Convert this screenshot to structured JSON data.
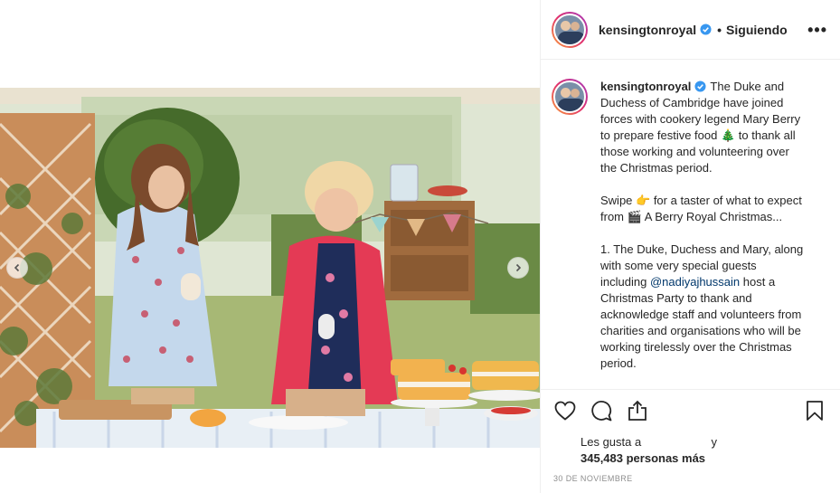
{
  "post": {
    "username": "kensingtonroyal",
    "separator": "•",
    "follow_label": "Siguiendo",
    "more_label": "•••",
    "caption_lines": [
      "The Duke and",
      "Duchess of Cambridge have joined",
      "forces with cookery legend Mary Berry",
      "to prepare festive food 🎄 to thank all",
      "those working and volunteering over",
      "the Christmas period.",
      "",
      "Swipe 👉 for a taster of what to expect",
      "from 🎬 A Berry Royal Christmas...",
      "",
      "1. The Duke, Duchess and Mary, along",
      "with some very special guests",
      "including ",
      "host a",
      "Christmas Party to thank and",
      "acknowledge staff and volunteers from",
      "charities and organisations who will be",
      "working tirelessly over the Christmas",
      "period."
    ],
    "mention": "@nadiyajhussain",
    "likes_prefix": "Les gusta a",
    "likes_and": "y",
    "likes_count": "345,483 personas más",
    "date": "30 DE NOVIEMBRE"
  },
  "icons": {
    "verified": "verified-badge-icon",
    "like": "heart-icon",
    "comment": "comment-icon",
    "share": "share-icon",
    "save": "bookmark-icon",
    "prev": "chevron-left-icon",
    "next": "chevron-right-icon"
  },
  "colors": {
    "verified": "#3897f0",
    "text": "#262626",
    "muted": "#8e8e8e",
    "mention": "#00376b",
    "border": "#efefef"
  }
}
